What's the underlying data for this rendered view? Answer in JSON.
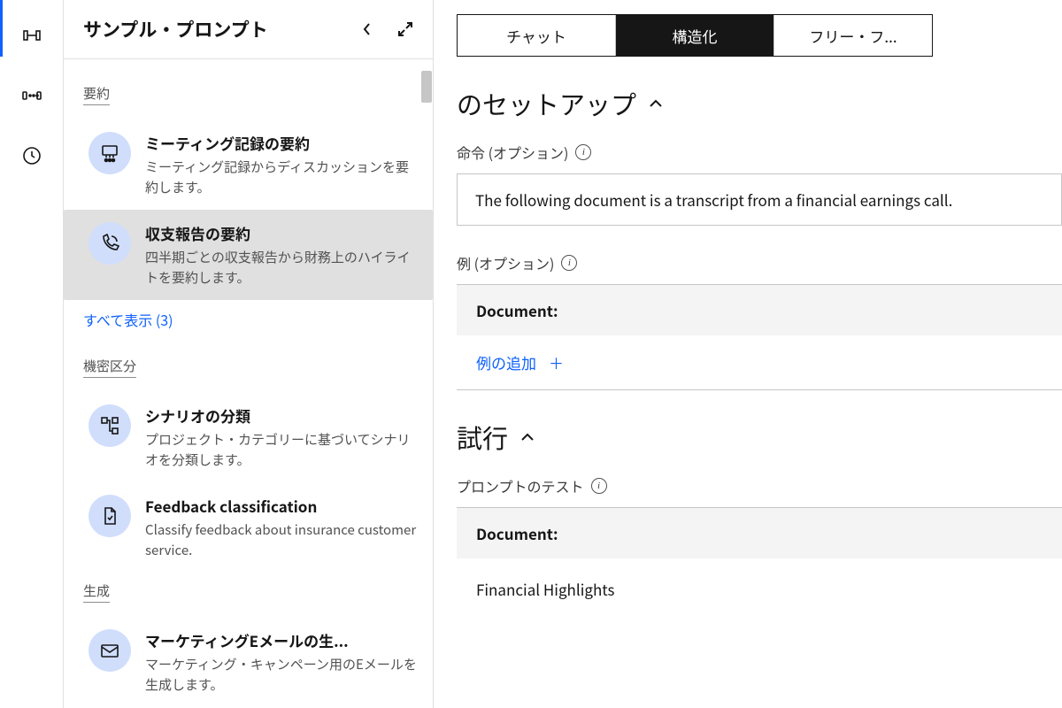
{
  "sidebar": {
    "title": "サンプル・プロンプト",
    "sections": [
      {
        "label": "要約",
        "items": [
          {
            "icon": "meeting",
            "title": "ミーティング記録の要約",
            "desc": "ミーティング記録からディスカッションを要約します。"
          },
          {
            "icon": "phone",
            "title": "収支報告の要約",
            "desc": "四半期ごとの収支報告から財務上のハイライトを要約します。",
            "selected": true
          }
        ],
        "show_all": "すべて表示 (3)"
      },
      {
        "label": "機密区分",
        "items": [
          {
            "icon": "tree",
            "title": "シナリオの分類",
            "desc": "プロジェクト・カテゴリーに基づいてシナリオを分類します。"
          },
          {
            "icon": "doc",
            "title": "Feedback classification",
            "desc": "Classify feedback about insurance customer service."
          }
        ]
      },
      {
        "label": "生成",
        "items": [
          {
            "icon": "mail",
            "title": "マーケティングEメールの生...",
            "desc": "マーケティング・キャンペーン用のEメールを生成します。"
          }
        ]
      }
    ]
  },
  "tabs": {
    "chat": "チャット",
    "structured": "構造化",
    "free": "フリー・フ..."
  },
  "setup": {
    "title": "のセットアップ",
    "instruction_label": "命令 (オプション)",
    "instruction_value": "The following document is a transcript from a financial earnings call.",
    "example_label": "例 (オプション)",
    "example_header": "Document:",
    "add_example": "例の追加"
  },
  "trial": {
    "title": "試行",
    "test_label": "プロンプトのテスト",
    "doc_header": "Document:",
    "doc_body": "Financial Highlights"
  }
}
